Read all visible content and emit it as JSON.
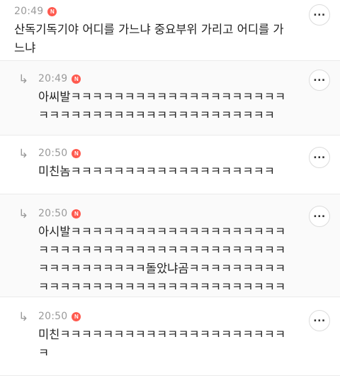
{
  "comments": [
    {
      "time": "20:49",
      "badge": "N",
      "text": "산독기독기야 어디를 가느냐 중요부위 가리고 어디를 가느냐",
      "more": "..."
    },
    {
      "time": "20:49",
      "badge": "N",
      "text": "아씨발ㅋㅋㅋㅋㅋㅋㅋㅋㅋㅋㅋㅋㅋㅋㅋㅋㅋㅋㅋㅋㅋㅋㅋㅋㅋㅋㅋㅋㅋㅋㅋㅋㅋㅋㅋㅋㅋㅋㅋㅋㅋㅋ",
      "more": "..."
    },
    {
      "time": "20:50",
      "badge": "N",
      "text": "미친놈ㅋㅋㅋㅋㅋㅋㅋㅋㅋㅋㅋㅋㅋㅋㅋㅋㅋㅋㅋ",
      "more": "..."
    },
    {
      "time": "20:50",
      "badge": "N",
      "text": "아시발ㅋㅋㅋㅋㅋㅋㅋㅋㅋㅋㅋㅋㅋㅋㅋㅋㅋㅋㅋㅋㅋㅋㅋㅋㅋㅋㅋㅋㅋㅋㅋㅋㅋㅋㅋㅋㅋㅋㅋㅋㅋㅋㅋㅋㅋㅋㅋㅋㅋㅋㅋㅋㅋ돌았냐곰ㅋㅋㅋㅋㅋㅋㅋㅋㅋㅋㅋㅋㅋㅋㅋㅋㅋㅋㅋㅋㅋㅋㅋㅋㅋㅋㅋㅋㅋㅋㅋㅋㅋㅋㅋ",
      "more": "..."
    },
    {
      "time": "20:50",
      "badge": "N",
      "text": "미친ㅋㅋㅋㅋㅋㅋㅋㅋㅋㅋㅋㅋㅋㅋㅋㅋㅋㅋㅋㅋㅋㅋ",
      "more": "..."
    }
  ],
  "reply_arrow": "↳",
  "colors": {
    "badge": "#ff5a4f",
    "timestamp": "#9a9a9a",
    "divider": "#ebebeb"
  }
}
